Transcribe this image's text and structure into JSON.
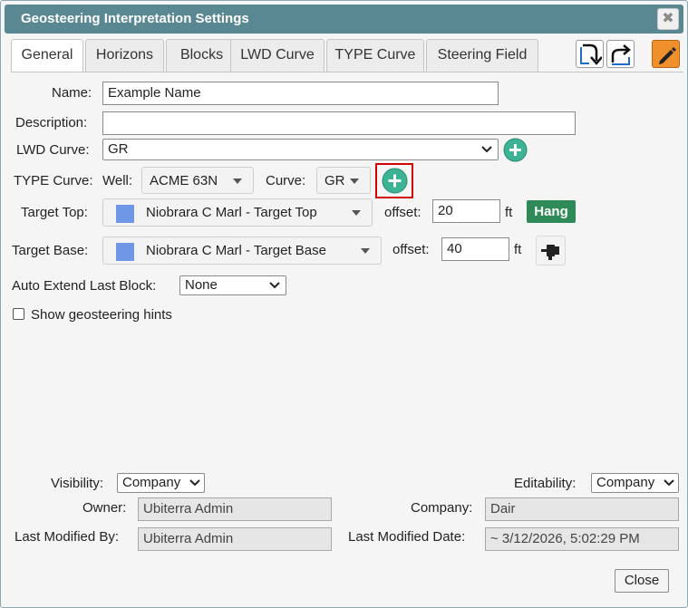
{
  "dialog": {
    "title": "Geosteering Interpretation Settings",
    "close_glyph": "✖"
  },
  "tabs": [
    {
      "label": "General",
      "active": true
    },
    {
      "label": "Horizons"
    },
    {
      "label": "Blocks"
    },
    {
      "label": "LWD Curve"
    },
    {
      "label": "TYPE Curve"
    },
    {
      "label": "Steering Field"
    }
  ],
  "toolbar": {
    "icons": [
      "import-icon",
      "share-icon",
      "pencil-icon"
    ]
  },
  "form": {
    "name": {
      "label": "Name:",
      "value": "Example Name"
    },
    "description": {
      "label": "Description:",
      "value": ""
    },
    "lwd_curve": {
      "label": "LWD Curve:",
      "value": "GR"
    },
    "type_curve": {
      "label": "TYPE Curve:",
      "well_label": "Well:",
      "well_value": "ACME 63N",
      "curve_label": "Curve:",
      "curve_value": "GR"
    },
    "target_top": {
      "label": "Target Top:",
      "value": "Niobrara C Marl - Target Top",
      "offset_label": "offset:",
      "offset_value": "20",
      "unit": "ft",
      "hang_label": "Hang"
    },
    "target_base": {
      "label": "Target Base:",
      "value": "Niobrara C Marl - Target Base",
      "offset_label": "offset:",
      "offset_value": "40",
      "unit": "ft"
    },
    "auto_extend": {
      "label": "Auto Extend Last Block:",
      "value": "None"
    },
    "hints": {
      "label": "Show geosteering hints",
      "checked": false
    }
  },
  "footer": {
    "visibility": {
      "label": "Visibility:",
      "value": "Company"
    },
    "editability": {
      "label": "Editability:",
      "value": "Company"
    },
    "owner": {
      "label": "Owner:",
      "value": "Ubiterra Admin"
    },
    "company": {
      "label": "Company:",
      "value": "Dair"
    },
    "last_modified_by": {
      "label": "Last Modified By:",
      "value": "Ubiterra Admin"
    },
    "last_modified_date": {
      "label": "Last Modified Date:",
      "value": "~ 3/12/2026, 5:02:29 PM"
    },
    "close_label": "Close"
  },
  "colors": {
    "titlebar": "#5a8892",
    "accent_green": "#2e8b57",
    "plus_teal": "#3bb394",
    "highlight": "#d20000",
    "swatch": "#6f97e6",
    "pencil_orange": "#f0902c"
  }
}
